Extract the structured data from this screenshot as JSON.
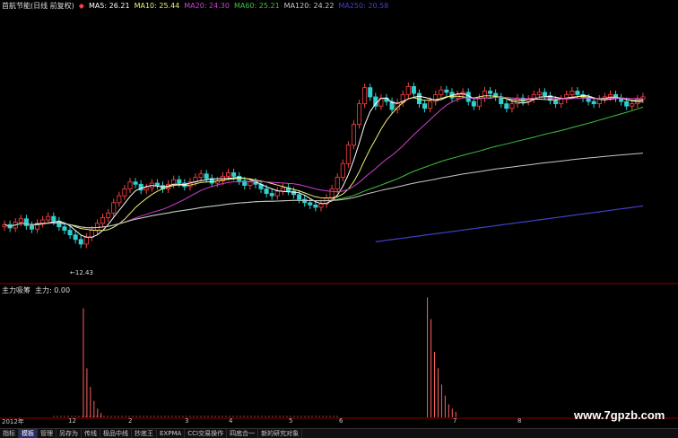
{
  "legend": {
    "title": "首航节能(日线 前复权)",
    "items": [
      {
        "text": "MA5: 26.21",
        "color": "#ffffff"
      },
      {
        "text": "MA10: 25.44",
        "color": "#f0f070"
      },
      {
        "text": "MA20: 24.30",
        "color": "#d040d0"
      },
      {
        "text": "MA60: 25.21",
        "color": "#40c040"
      },
      {
        "text": "MA120: 24.22",
        "color": "#c8c8c8"
      },
      {
        "text": "MA250: 20.58",
        "color": "#4040c8"
      }
    ]
  },
  "indicator": {
    "name": "主力吸筹",
    "line_label": "主力: 0.00"
  },
  "low_price_label": "←12.43",
  "time_axis": [
    "2012年",
    "12",
    "2",
    "3",
    "4",
    "5",
    "6",
    "7",
    "8"
  ],
  "watermark": "www.7gpzb.com",
  "bottom_tabs": [
    "指标",
    "模板",
    "管理",
    "另存为",
    "传线",
    "极品中线",
    "抄底王",
    "EXPMA",
    "CCI交易操作",
    "四底合一",
    "新的研究对象"
  ],
  "colors": {
    "up": "#ff4040",
    "down": "#30d0d0",
    "separator": "#8a0000",
    "volume": "#ff6060"
  },
  "chart_data": {
    "type": "candlestick",
    "note_values": "price values read approximately from chart",
    "closes": [
      20.5,
      20.2,
      20.7,
      21.0,
      20.4,
      20.1,
      20.6,
      20.9,
      21.2,
      20.8,
      20.3,
      20.0,
      19.6,
      19.2,
      18.8,
      19.4,
      20.0,
      20.6,
      21.1,
      21.5,
      22.4,
      23.0,
      23.6,
      24.2,
      24.0,
      23.5,
      23.7,
      24.1,
      23.9,
      23.6,
      24.0,
      24.4,
      24.1,
      23.8,
      24.2,
      24.6,
      24.9,
      24.5,
      24.1,
      24.3,
      24.7,
      25.0,
      24.7,
      24.3,
      23.9,
      24.2,
      24.0,
      23.6,
      23.2,
      23.0,
      23.4,
      23.7,
      23.4,
      23.1,
      22.7,
      22.4,
      22.2,
      22.0,
      22.3,
      22.8,
      23.6,
      24.6,
      25.8,
      27.4,
      29.2,
      31.0,
      32.4,
      31.6,
      30.8,
      31.5,
      31.2,
      30.5,
      31.1,
      31.8,
      32.5,
      31.9,
      31.0,
      30.6,
      31.2,
      31.8,
      32.2,
      32.0,
      31.5,
      31.8,
      32.0,
      31.2,
      30.8,
      31.5,
      32.1,
      31.9,
      31.6,
      31.0,
      30.6,
      31.0,
      31.5,
      31.2,
      31.4,
      31.8,
      32.0,
      31.7,
      31.3,
      31.0,
      31.4,
      31.8,
      32.1,
      31.8,
      31.5,
      31.2,
      31.0,
      31.4,
      31.6,
      31.8,
      31.5,
      31.2,
      30.8,
      31.0,
      31.4,
      31.6
    ],
    "low_marker": 12.43,
    "ma_latest": {
      "MA5": 26.21,
      "MA10": 25.44,
      "MA20": 24.3,
      "MA60": 25.21,
      "MA120": 24.22,
      "MA250": 20.58
    },
    "indicator_series_name": "主力",
    "indicator_latest": 0.0,
    "indicator_spikes": [
      {
        "index": 23,
        "value": 1.0
      },
      {
        "index": 24,
        "value": 0.45
      },
      {
        "index": 25,
        "value": 0.28
      },
      {
        "index": 26,
        "value": 0.15
      },
      {
        "index": 27,
        "value": 0.08
      },
      {
        "index": 28,
        "value": 0.04
      },
      {
        "index": 120,
        "value": 1.1
      },
      {
        "index": 121,
        "value": 0.9
      },
      {
        "index": 122,
        "value": 0.6
      },
      {
        "index": 123,
        "value": 0.45
      },
      {
        "index": 124,
        "value": 0.3
      },
      {
        "index": 125,
        "value": 0.2
      },
      {
        "index": 126,
        "value": 0.12
      },
      {
        "index": 127,
        "value": 0.08
      },
      {
        "index": 128,
        "value": 0.05
      }
    ]
  }
}
